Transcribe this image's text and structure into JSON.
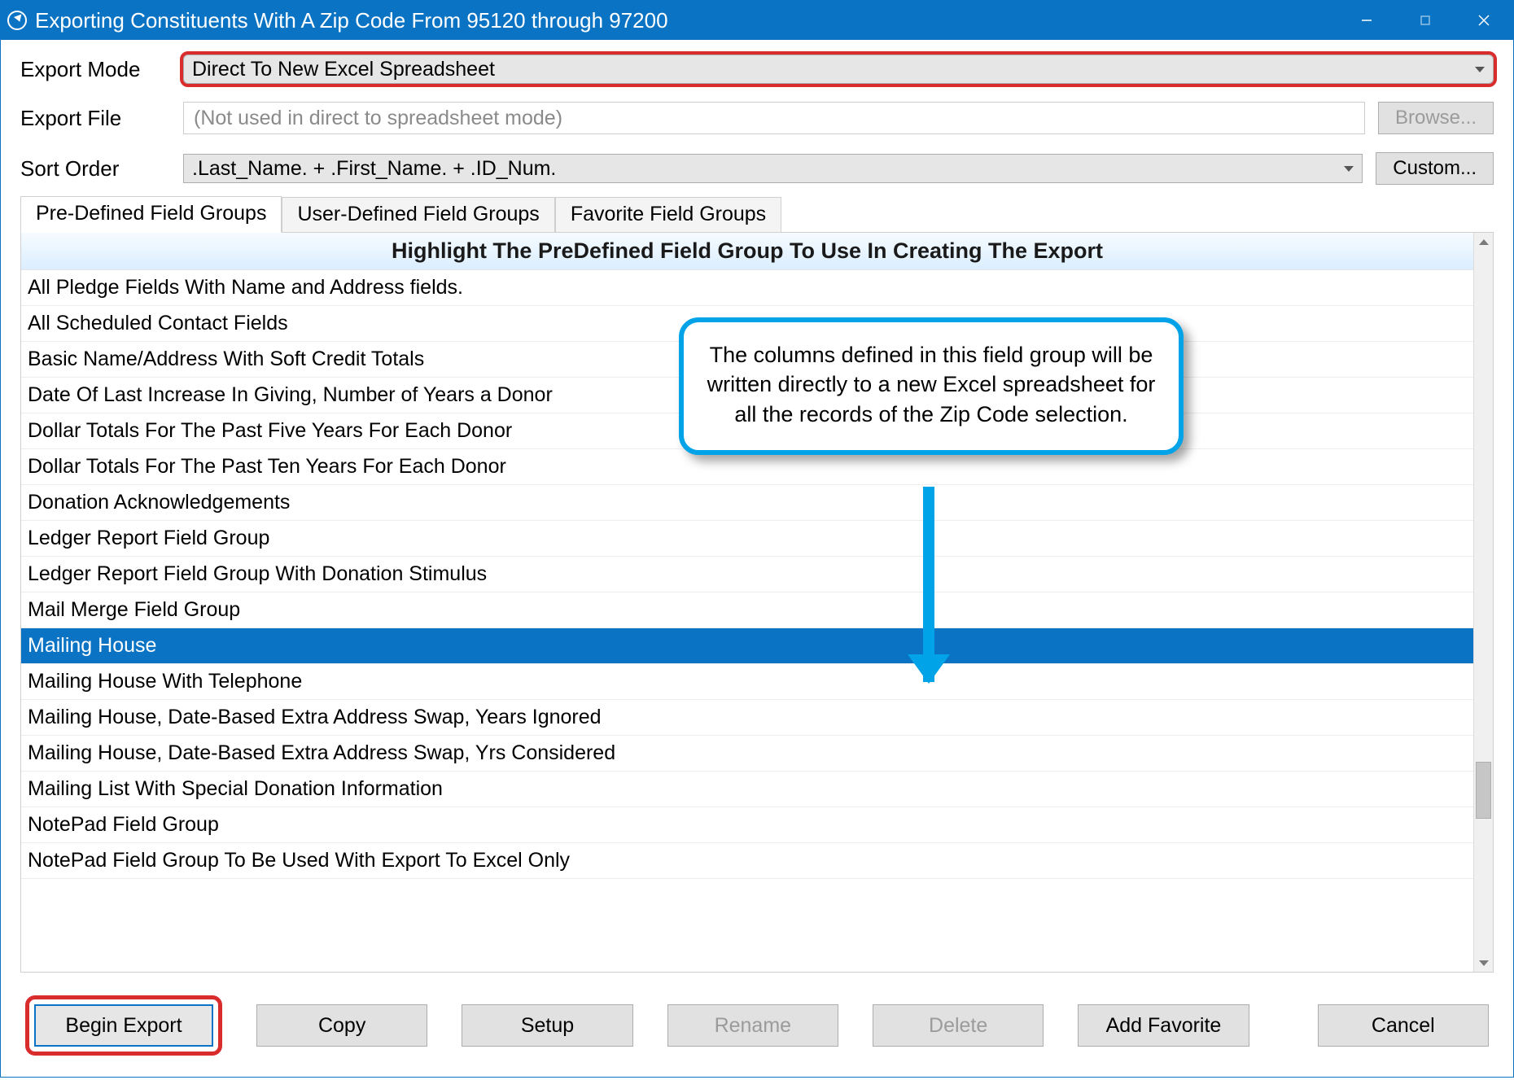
{
  "title": "Exporting Constituents With A Zip Code From 95120 through 97200",
  "labels": {
    "export_mode": "Export Mode",
    "export_file": "Export File",
    "sort_order": "Sort Order"
  },
  "export_mode_value": "Direct To New Excel Spreadsheet",
  "export_file_placeholder": "(Not used in direct to spreadsheet mode)",
  "sort_order_value": ".Last_Name. + .First_Name. + .ID_Num.",
  "browse_label": "Browse...",
  "custom_label": "Custom...",
  "tabs": [
    "Pre-Defined Field Groups",
    "User-Defined Field Groups",
    "Favorite Field Groups"
  ],
  "active_tab": 0,
  "list_header": "Highlight The PreDefined Field Group To Use In Creating The Export",
  "field_groups": [
    "All Pledge Fields With Name and Address fields.",
    "All Scheduled Contact Fields",
    "Basic Name/Address With Soft Credit Totals",
    "Date Of Last Increase In Giving, Number of Years a Donor",
    "Dollar Totals For The Past Five Years For Each Donor",
    "Dollar Totals For The Past Ten Years For Each Donor",
    "Donation Acknowledgements",
    "Ledger Report Field Group",
    "Ledger Report Field Group With Donation Stimulus",
    "Mail Merge Field Group",
    "Mailing House",
    "Mailing House With Telephone",
    "Mailing House, Date-Based Extra Address Swap, Years Ignored",
    "Mailing House, Date-Based Extra Address Swap, Yrs Considered",
    "Mailing List With Special Donation Information",
    "NotePad Field Group",
    "NotePad Field Group To Be Used With Export To Excel Only"
  ],
  "selected_field_group": 10,
  "callout_text": "The columns defined in this field group will be written directly to a new Excel spreadsheet for all the records of the Zip Code selection.",
  "buttons": {
    "begin": "Begin Export",
    "copy": "Copy",
    "setup": "Setup",
    "rename": "Rename",
    "delete": "Delete",
    "add_favorite": "Add Favorite",
    "cancel": "Cancel"
  }
}
